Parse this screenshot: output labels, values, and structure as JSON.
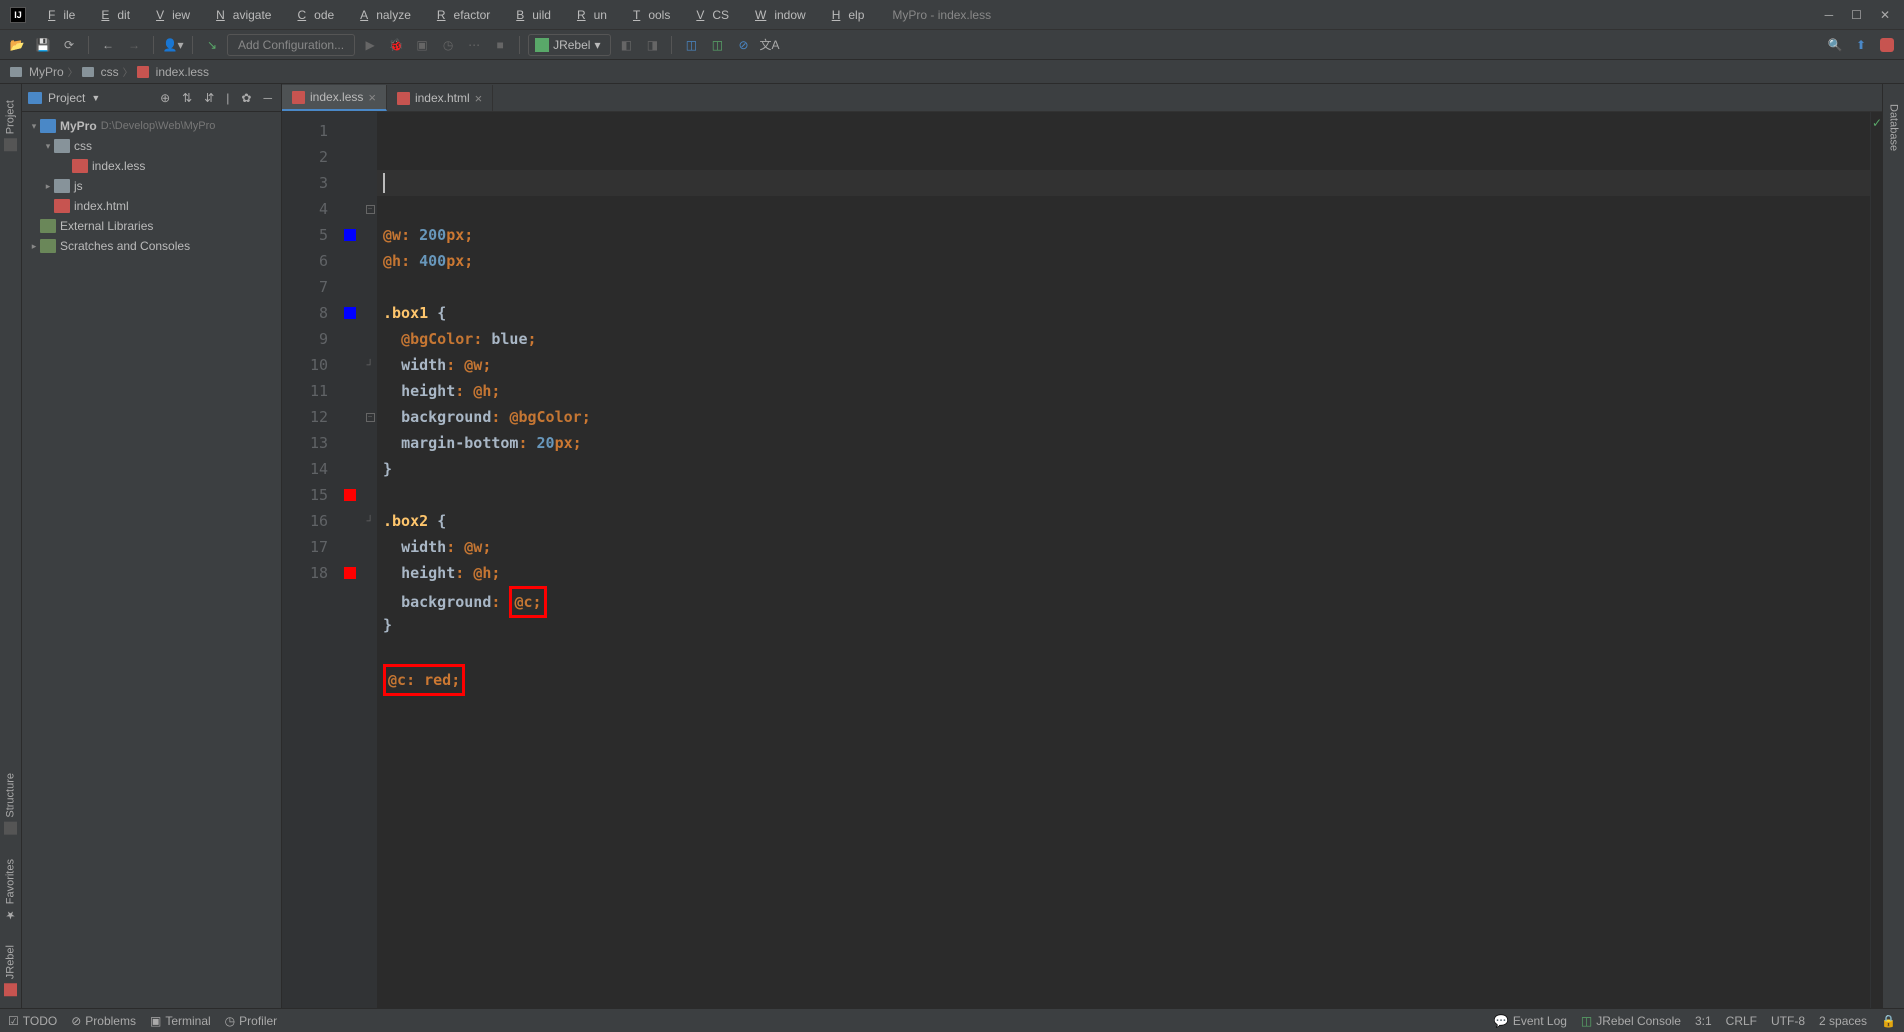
{
  "title": "MyPro - index.less",
  "menu": [
    "File",
    "Edit",
    "View",
    "Navigate",
    "Code",
    "Analyze",
    "Refactor",
    "Build",
    "Run",
    "Tools",
    "VCS",
    "Window",
    "Help"
  ],
  "toolbar": {
    "config_label": "Add Configuration...",
    "jrebel_label": "JRebel"
  },
  "breadcrumb": [
    "MyPro",
    "css",
    "index.less"
  ],
  "sidebar": {
    "header": "Project",
    "tree": {
      "root": "MyPro",
      "root_path": "D:\\Develop\\Web\\MyPro",
      "css_folder": "css",
      "index_less": "index.less",
      "js_folder": "js",
      "index_html": "index.html",
      "external_libs": "External Libraries",
      "scratches": "Scratches and Consoles"
    }
  },
  "tabs": [
    {
      "name": "index.less",
      "active": true
    },
    {
      "name": "index.html",
      "active": false
    }
  ],
  "left_tools": [
    "Project",
    "Structure",
    "Favorites",
    "JRebel"
  ],
  "right_tools": [
    "Database"
  ],
  "code_lines": [
    {
      "n": 1,
      "tokens": [
        [
          "var",
          "@w"
        ],
        [
          "punc",
          ": "
        ],
        [
          "num",
          "200"
        ],
        [
          "unit",
          "px"
        ],
        [
          "punc",
          ";"
        ]
      ]
    },
    {
      "n": 2,
      "tokens": [
        [
          "var",
          "@h"
        ],
        [
          "punc",
          ": "
        ],
        [
          "num",
          "400"
        ],
        [
          "unit",
          "px"
        ],
        [
          "punc",
          ";"
        ]
      ]
    },
    {
      "n": 3,
      "tokens": []
    },
    {
      "n": 4,
      "tokens": [
        [
          "sel",
          ".box1 "
        ],
        [
          "brace",
          "{"
        ]
      ],
      "fold": "open"
    },
    {
      "n": 5,
      "glyph": "blue",
      "indent": 1,
      "tokens": [
        [
          "var",
          "@bgColor"
        ],
        [
          "punc",
          ": "
        ],
        [
          "val",
          "blue"
        ],
        [
          "punc",
          ";"
        ]
      ]
    },
    {
      "n": 6,
      "indent": 1,
      "tokens": [
        [
          "prop",
          "width"
        ],
        [
          "punc",
          ": "
        ],
        [
          "var",
          "@w"
        ],
        [
          "punc",
          ";"
        ]
      ]
    },
    {
      "n": 7,
      "indent": 1,
      "tokens": [
        [
          "prop",
          "height"
        ],
        [
          "punc",
          ": "
        ],
        [
          "var",
          "@h"
        ],
        [
          "punc",
          ";"
        ]
      ]
    },
    {
      "n": 8,
      "glyph": "blue",
      "indent": 1,
      "tokens": [
        [
          "prop",
          "background"
        ],
        [
          "punc",
          ": "
        ],
        [
          "var",
          "@bgColor"
        ],
        [
          "punc",
          ";"
        ]
      ]
    },
    {
      "n": 9,
      "indent": 1,
      "tokens": [
        [
          "prop",
          "margin-bottom"
        ],
        [
          "punc",
          ": "
        ],
        [
          "num",
          "20"
        ],
        [
          "unit",
          "px"
        ],
        [
          "punc",
          ";"
        ]
      ]
    },
    {
      "n": 10,
      "tokens": [
        [
          "brace",
          "}"
        ]
      ],
      "fold": "close"
    },
    {
      "n": 11,
      "tokens": []
    },
    {
      "n": 12,
      "tokens": [
        [
          "sel",
          ".box2 "
        ],
        [
          "brace",
          "{"
        ]
      ],
      "fold": "open"
    },
    {
      "n": 13,
      "indent": 1,
      "tokens": [
        [
          "prop",
          "width"
        ],
        [
          "punc",
          ": "
        ],
        [
          "var",
          "@w"
        ],
        [
          "punc",
          ";"
        ]
      ]
    },
    {
      "n": 14,
      "indent": 1,
      "tokens": [
        [
          "prop",
          "height"
        ],
        [
          "punc",
          ": "
        ],
        [
          "var",
          "@h"
        ],
        [
          "punc",
          ";"
        ]
      ]
    },
    {
      "n": 15,
      "glyph": "red",
      "indent": 1,
      "tokens": [
        [
          "prop",
          "background"
        ],
        [
          "punc",
          ": "
        ]
      ],
      "hl_tokens": [
        [
          "var",
          "@c"
        ],
        [
          "punc",
          ";"
        ]
      ]
    },
    {
      "n": 16,
      "tokens": [
        [
          "brace",
          "}"
        ]
      ],
      "fold": "close"
    },
    {
      "n": 17,
      "tokens": []
    },
    {
      "n": 18,
      "glyph": "red",
      "hl_whole": true,
      "tokens": [
        [
          "var",
          "@c"
        ],
        [
          "punc",
          ": "
        ],
        [
          "kw",
          "red"
        ],
        [
          "punc",
          ";"
        ]
      ]
    }
  ],
  "statusbar": {
    "todo": "TODO",
    "problems": "Problems",
    "terminal": "Terminal",
    "profiler": "Profiler",
    "event_log": "Event Log",
    "jrebel_console": "JRebel Console",
    "cursor": "3:1",
    "lineend": "CRLF",
    "encoding": "UTF-8",
    "indent": "2 spaces"
  }
}
